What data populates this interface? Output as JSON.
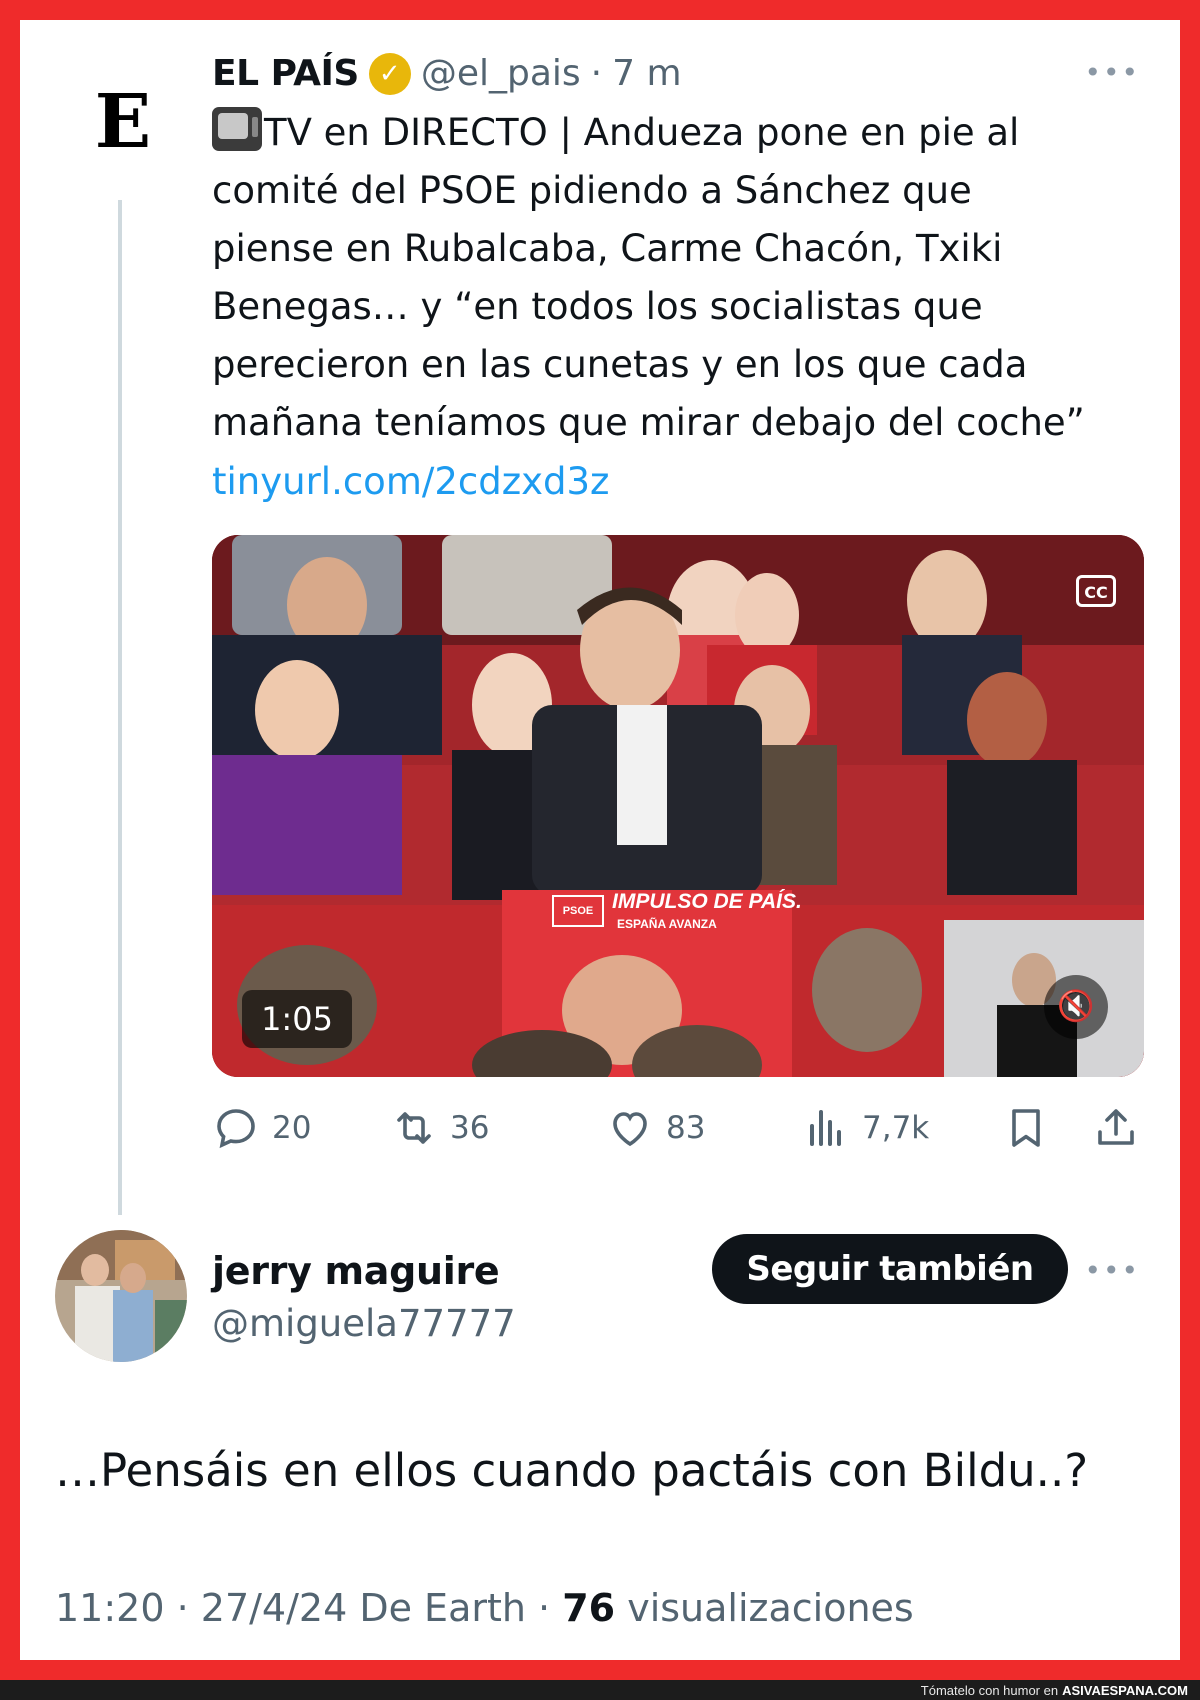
{
  "quoted_tweet": {
    "author_name": "EL PAÍS",
    "logo_letter": "E",
    "verified_icon": "verified-gold-badge",
    "handle": "@el_pais",
    "separator": "·",
    "time": "7 m",
    "more_icon": "more-options-icon",
    "more_glyph": "•••",
    "emoji_icon": "tv-emoji",
    "text": "TV en DIRECTO | Andueza pone en pie al\ncomité del PSOE pidiendo a Sánchez que\npiense en Rubalcaba, Carme Chacón, Txiki\nBenegas… y “en todos los socialistas que\nperecieron en las cunetas y en los que cada\nmañana teníamos que mirar debajo del coche”",
    "link": "tinyurl.com/2cdzxd3z",
    "video": {
      "duration": "1:05",
      "cc_label": "CC",
      "mute_glyph": "🔇",
      "banner_logo": "PSOE",
      "banner_title": "IMPULSO DE PAÍS.",
      "banner_subtitle": "ESPAÑA AVANZA"
    },
    "actions": {
      "replies": "20",
      "reposts": "36",
      "likes": "83",
      "views": "7,7k"
    }
  },
  "reply_tweet": {
    "author_name": "jerry maguire",
    "handle": "@miguela77777",
    "follow_label": "Seguir también",
    "text": "…Pensáis en ellos cuando pactáis con Bildu..?",
    "time": "11:20",
    "date_source": "27/4/24 De Earth",
    "views_count": "76",
    "views_label": "visualizaciones"
  },
  "footer": {
    "tagline": "Tómatelo con humor en",
    "site": "ASIVAESPANA.COM"
  },
  "colors": {
    "frame": "#ef2b2b",
    "link": "#1d9bf0",
    "muted": "#536471",
    "verified": "#e8b70b"
  }
}
